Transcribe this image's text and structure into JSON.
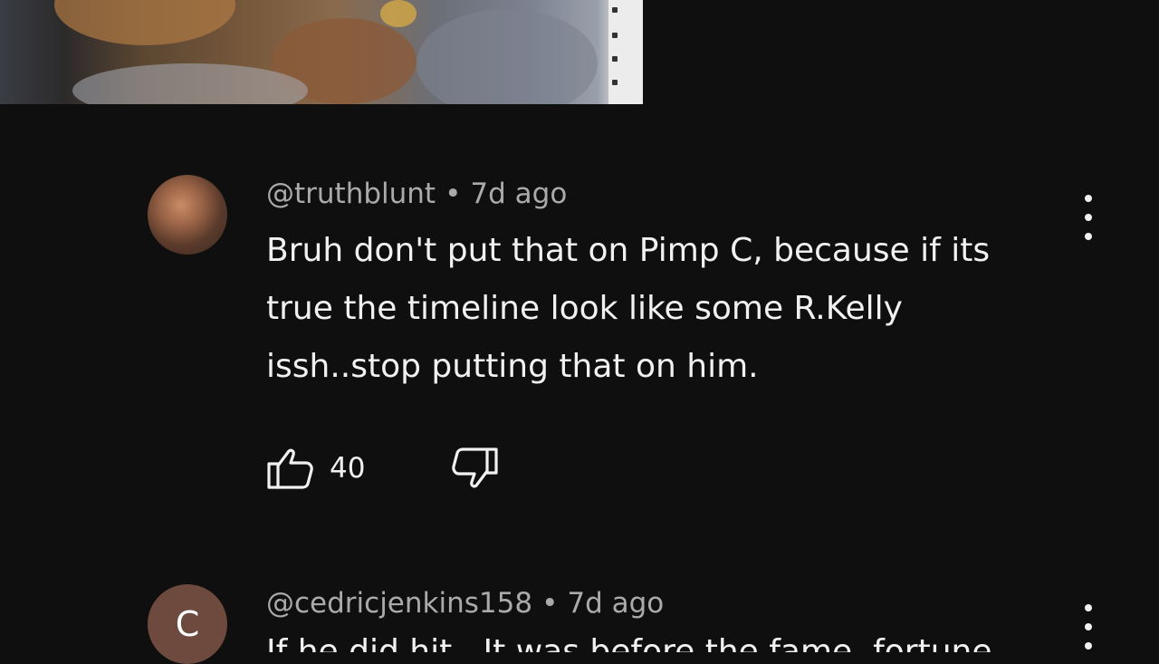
{
  "comments": [
    {
      "handle": "@truthblunt",
      "separator": "•",
      "time": "7d ago",
      "text": "Bruh don't put that on Pimp C, because if its true the timeline look like some R.Kelly issh..stop putting that on him.",
      "likes": "40"
    },
    {
      "handle": "@cedricjenkins158",
      "separator": "•",
      "time": "7d ago",
      "avatar_letter": "C",
      "text": "If he did hit.. It was before the fame, fortune"
    }
  ],
  "icons": {
    "like": "thumbs-up-icon",
    "dislike": "thumbs-down-icon",
    "menu": "more-vert-icon"
  },
  "colors": {
    "background": "#0f0f0f",
    "text": "#f1f1f1",
    "meta": "#aaaaaa",
    "avatar_letter_bg": "#6d4a3d"
  }
}
